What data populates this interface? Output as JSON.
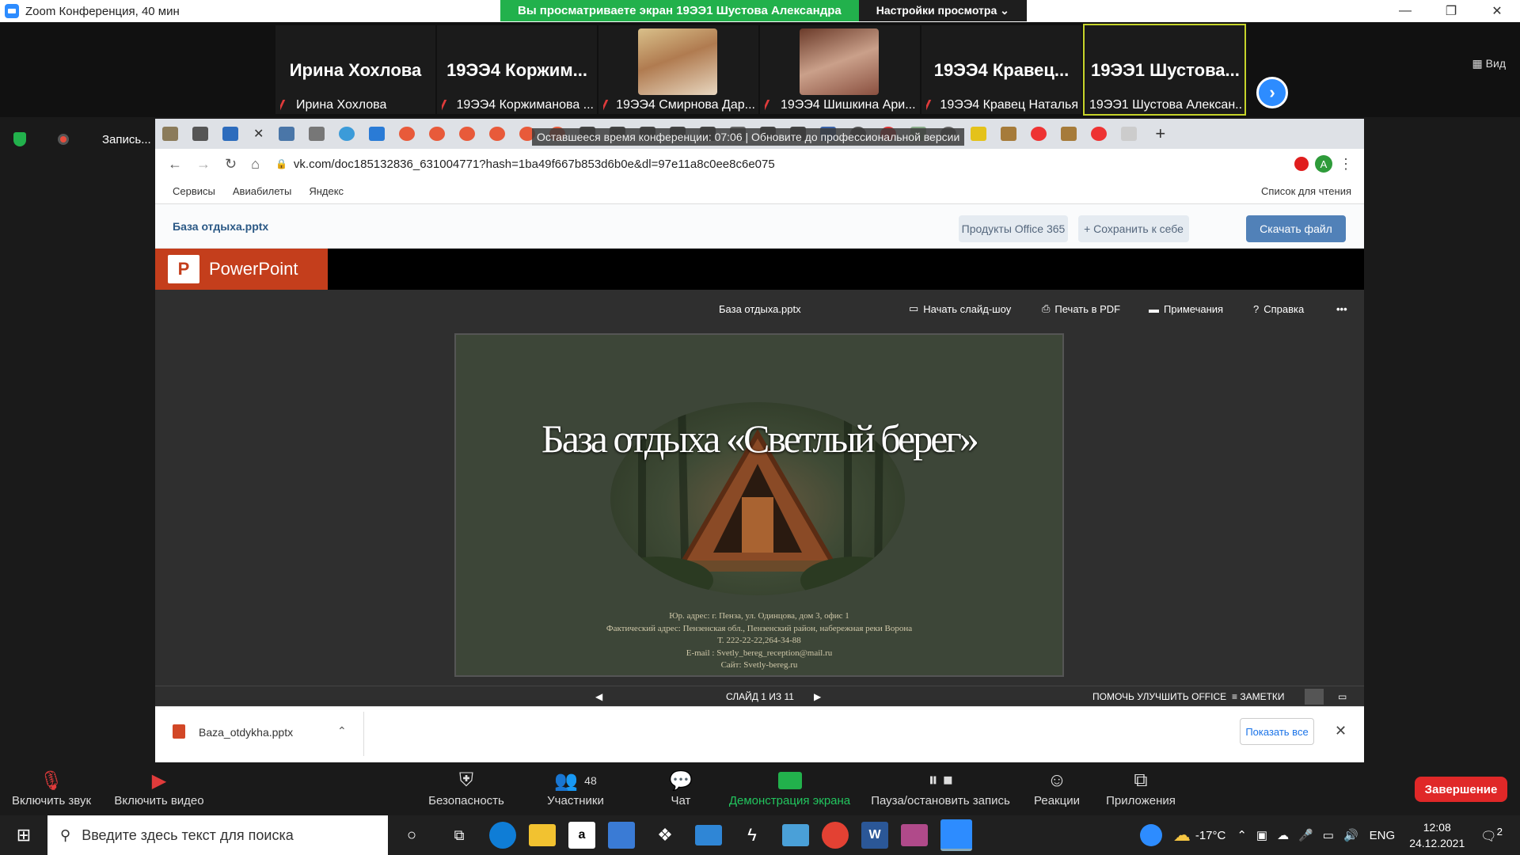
{
  "zoom": {
    "title": "Zoom Конференция, 40 мин",
    "viewing_banner": "Вы просматриваете экран 19ЭЭ1 Шустова Александра",
    "view_settings": "Настройки просмотра ⌄",
    "view_label": "Вид",
    "recording": "Запись..."
  },
  "participants": [
    {
      "big": "Ирина Хохлова",
      "small": "Ирина Хохлова"
    },
    {
      "big": "19ЭЭ4 Коржим...",
      "small": "19ЭЭ4 Коржиманова ..."
    },
    {
      "big": "",
      "small": "19ЭЭ4 Смирнова Дар..."
    },
    {
      "big": "",
      "small": "19ЭЭ4 Шишкина Ари..."
    },
    {
      "big": "19ЭЭ4 Кравец...",
      "small": "19ЭЭ4 Кравец Наталья"
    },
    {
      "big": "19ЭЭ1 Шустова...",
      "small": "19ЭЭ1 Шустова Алексан..."
    }
  ],
  "browser": {
    "conf_banner": "Оставшееся время конференции: 07:06 | Обновите до профессиональной версии",
    "url": "vk.com/doc185132836_631004771?hash=1ba49f667b853d6b0e&dl=97e11a8c0ee8c6e075",
    "bookmarks": [
      "Сервисы",
      "Авиабилеты",
      "Яндекс"
    ],
    "reading_list": "Список для чтения"
  },
  "vk": {
    "filename": "База отдыха.pptx",
    "office_btn": "Продукты Office 365",
    "save_btn": "+ Сохранить к себе",
    "download_btn": "Скачать файл"
  },
  "ppt": {
    "app_name": "PowerPoint",
    "file": "База отдыха.pptx",
    "slideshow": "Начать слайд-шоу",
    "print_pdf": "Печать в PDF",
    "notes": "Примечания",
    "help": "Справка",
    "more": "•••",
    "slide_title": "База отдыха «Светлый берег»",
    "details": [
      "Юр. адрес: г. Пенза, ул. Одинцова, дом 3, офис 1",
      "Фактический адрес: Пензенская обл., Пензенский район, набережная реки Ворона",
      "Т. 222-22-22,264-34-88",
      "E-mail : Svetly_bereg_reception@mail.ru",
      "Сайт: Svetly-bereg.ru"
    ],
    "slide_counter": "СЛАЙД 1 ИЗ 11",
    "improve": "ПОМОЧЬ УЛУЧШИТЬ OFFICE",
    "notes_label": "ЗАМЕТКИ"
  },
  "download": {
    "file": "Baza_otdykha.pptx",
    "show_all": "Показать все"
  },
  "controls": {
    "audio": "Включить звук",
    "video": "Включить видео",
    "security": "Безопасность",
    "participants": "Участники",
    "participants_count": "48",
    "chat": "Чат",
    "share": "Демонстрация экрана",
    "record": "Пауза/остановить запись",
    "reactions": "Реакции",
    "apps": "Приложения",
    "end": "Завершение"
  },
  "taskbar": {
    "search_placeholder": "Введите здесь текст для поиска",
    "temp": "-17°C",
    "lang": "ENG",
    "time": "12:08",
    "date": "24.12.2021",
    "notif": "2"
  }
}
